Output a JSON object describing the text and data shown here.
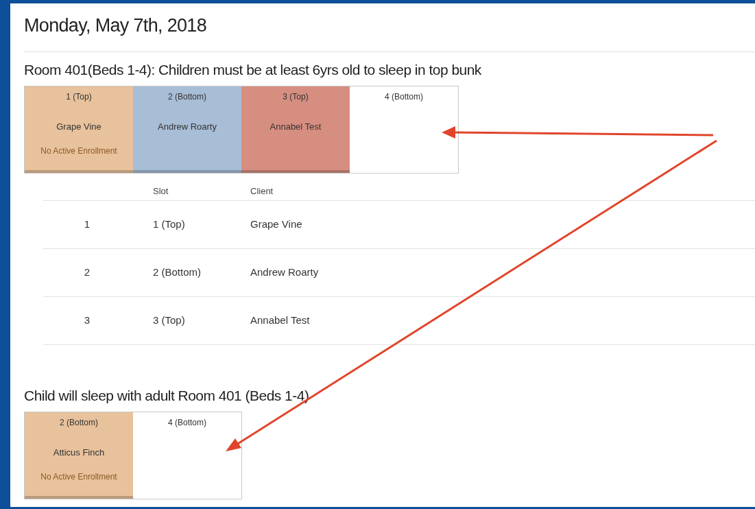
{
  "date_title": "Monday, May 7th, 2018",
  "sections": [
    {
      "title": "Room 401(Beds 1-4): Children must be at least 6yrs old to sleep in top bunk",
      "beds": [
        {
          "label": "1 (Top)",
          "client": "Grape Vine",
          "note": "No Active Enrollment",
          "color": "#e8c29c"
        },
        {
          "label": "2 (Bottom)",
          "client": "Andrew Roarty",
          "color": "#a8bdd6"
        },
        {
          "label": "3 (Top)",
          "client": "Annabel Test",
          "color": "#d68e80"
        },
        {
          "label": "4 (Bottom)",
          "color": "#ffffff"
        }
      ],
      "table": {
        "columns": [
          "",
          "Slot",
          "Client"
        ],
        "rows": [
          [
            "1",
            "1 (Top)",
            "Grape Vine"
          ],
          [
            "2",
            "2 (Bottom)",
            "Andrew Roarty"
          ],
          [
            "3",
            "3 (Top)",
            "Annabel Test"
          ]
        ]
      }
    },
    {
      "title": "Child will sleep with adult Room 401 (Beds 1-4)",
      "beds": [
        {
          "label": "2 (Bottom)",
          "client": "Atticus Finch",
          "note": "No Active Enrollment",
          "color": "#e8c29c"
        },
        {
          "label": "4 (Bottom)",
          "color": "#ffffff"
        }
      ]
    }
  ]
}
